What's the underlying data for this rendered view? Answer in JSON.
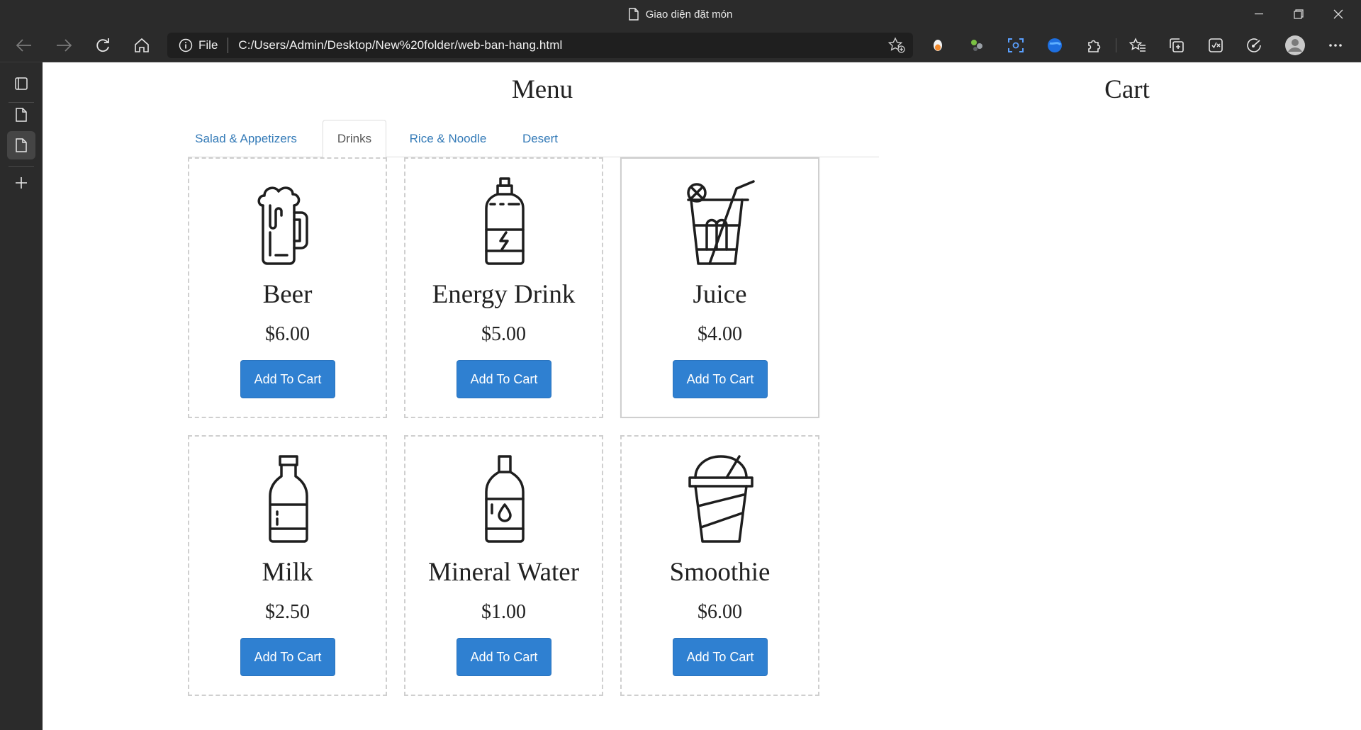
{
  "window": {
    "title": "Giao diện đặt món"
  },
  "address_bar": {
    "scheme_label": "File",
    "url": "C:/Users/Admin/Desktop/New%20folder/web-ban-hang.html"
  },
  "page": {
    "menu_heading": "Menu",
    "cart_heading": "Cart",
    "tabs": [
      {
        "label": "Salad & Appetizers",
        "active": false
      },
      {
        "label": "Drinks",
        "active": true
      },
      {
        "label": "Rice & Noodle",
        "active": false
      },
      {
        "label": "Desert",
        "active": false
      }
    ],
    "products": [
      {
        "name": "Beer",
        "price": "$6.00",
        "button": "Add To Cart",
        "icon": "beer-mug-icon"
      },
      {
        "name": "Energy Drink",
        "price": "$5.00",
        "button": "Add To Cart",
        "icon": "energy-drink-bottle-icon"
      },
      {
        "name": "Juice",
        "price": "$4.00",
        "button": "Add To Cart",
        "icon": "juice-glass-icon"
      },
      {
        "name": "Milk",
        "price": "$2.50",
        "button": "Add To Cart",
        "icon": "milk-bottle-icon"
      },
      {
        "name": "Mineral Water",
        "price": "$1.00",
        "button": "Add To Cart",
        "icon": "water-bottle-icon"
      },
      {
        "name": "Smoothie",
        "price": "$6.00",
        "button": "Add To Cart",
        "icon": "smoothie-cup-icon"
      }
    ]
  },
  "colors": {
    "chrome_bg": "#2b2b2b",
    "address_bg": "#1f1f1f",
    "link_blue": "#337ab7",
    "button_blue": "#2f80d1"
  }
}
